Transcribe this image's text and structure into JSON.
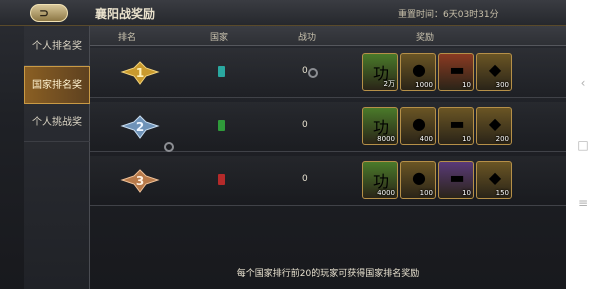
{
  "header": {
    "title": "襄阳战奖励",
    "reset_time": "重置时间：6天03时31分"
  },
  "sidebar": {
    "items": [
      {
        "label": "个人排名奖",
        "active": false
      },
      {
        "label": "国家排名奖",
        "active": true
      },
      {
        "label": "个人挑战奖",
        "active": false
      }
    ]
  },
  "table": {
    "columns": [
      "排名",
      "国家",
      "战功",
      "奖励"
    ],
    "rows": [
      {
        "rank": "1",
        "country_color": "#2aa8a0",
        "merit": "0",
        "rewards": [
          {
            "icon": "merit-token-icon",
            "qty": "2万",
            "bg": "#4a7a2a"
          },
          {
            "icon": "gold-ingot-icon",
            "qty": "1000",
            "bg": "#6a5524"
          },
          {
            "icon": "scroll-icon",
            "qty": "10",
            "bg": "#8a3a22"
          },
          {
            "icon": "gem-icon",
            "qty": "300",
            "bg": "#6a5524"
          }
        ]
      },
      {
        "rank": "2",
        "country_color": "#2f9a3a",
        "merit": "0",
        "rewards": [
          {
            "icon": "merit-token-icon",
            "qty": "8000",
            "bg": "#4a7a2a"
          },
          {
            "icon": "gold-ingot-icon",
            "qty": "400",
            "bg": "#6a5524"
          },
          {
            "icon": "scroll-icon",
            "qty": "10",
            "bg": "#6a5524"
          },
          {
            "icon": "gem-icon",
            "qty": "200",
            "bg": "#6a5524"
          }
        ]
      },
      {
        "rank": "3",
        "country_color": "#b52a2a",
        "merit": "0",
        "rewards": [
          {
            "icon": "merit-token-icon",
            "qty": "4000",
            "bg": "#4a7a2a"
          },
          {
            "icon": "gold-ingot-icon",
            "qty": "100",
            "bg": "#6a5524"
          },
          {
            "icon": "scroll-icon",
            "qty": "10",
            "bg": "#5a3a78"
          },
          {
            "icon": "gem-icon",
            "qty": "150",
            "bg": "#6a5524"
          }
        ]
      }
    ]
  },
  "footer": {
    "note": "每个国家排行前20的玩家可获得国家排名奖励"
  }
}
